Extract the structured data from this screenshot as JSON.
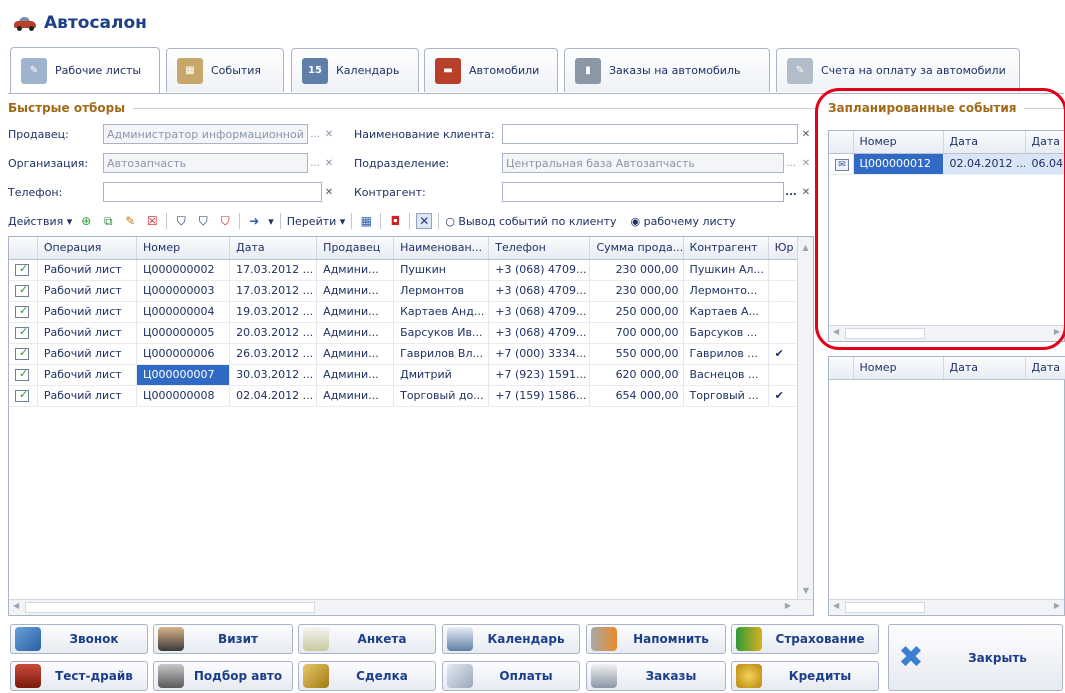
{
  "window": {
    "title": "Автосалон"
  },
  "tabs": [
    {
      "label": "Рабочие листы",
      "icon": "worksheet-icon"
    },
    {
      "label": "События",
      "icon": "events-icon"
    },
    {
      "label": "Календарь",
      "icon": "calendar-icon"
    },
    {
      "label": "Автомобили",
      "icon": "car-icon"
    },
    {
      "label": "Заказы на автомобиль",
      "icon": "order-icon"
    },
    {
      "label": "Счета на оплату за автомобили",
      "icon": "invoice-icon"
    }
  ],
  "filters": {
    "section_title": "Быстрые отборы",
    "seller_label": "Продавец:",
    "seller_value": "Администратор информационной",
    "client_label": "Наименование клиента:",
    "client_value": "",
    "org_label": "Организация:",
    "org_value": "Автозапчасть",
    "dept_label": "Подразделение:",
    "dept_value": "Центральная база Автозапчасть",
    "phone_label": "Телефон:",
    "phone_value": "",
    "contractor_label": "Контрагент:",
    "contractor_value": ""
  },
  "toolbar": {
    "actions_label": "Действия",
    "goto_label": "Перейти",
    "radio_client_label": "Вывод событий по клиенту",
    "radio_sheet_label": "рабочему листу"
  },
  "table": {
    "columns": [
      "Операция",
      "Номер",
      "Дата",
      "Продавец",
      "Наименован...",
      "Телефон",
      "Сумма прода...",
      "Контрагент",
      "Юр"
    ],
    "rows": [
      {
        "op": "Рабочий лист",
        "num": "Ц000000002",
        "date": "17.03.2012 ...",
        "seller": "Админи...",
        "name": "Пушкин",
        "phone": "+3 (068) 4709...",
        "sum": "230 000,00",
        "contractor": "Пушкин Ал...",
        "jur": ""
      },
      {
        "op": "Рабочий лист",
        "num": "Ц000000003",
        "date": "17.03.2012 ...",
        "seller": "Админи...",
        "name": "Лермонтов",
        "phone": "+3 (068) 4709...",
        "sum": "230 000,00",
        "contractor": "Лермонто...",
        "jur": ""
      },
      {
        "op": "Рабочий лист",
        "num": "Ц000000004",
        "date": "19.03.2012 ...",
        "seller": "Админи...",
        "name": "Картаев Анд...",
        "phone": "+3 (068) 4709...",
        "sum": "250 000,00",
        "contractor": "Картаев А...",
        "jur": ""
      },
      {
        "op": "Рабочий лист",
        "num": "Ц000000005",
        "date": "20.03.2012 ...",
        "seller": "Админи...",
        "name": "Барсуков Ив...",
        "phone": "+3 (068) 4709...",
        "sum": "700 000,00",
        "contractor": "Барсуков ...",
        "jur": ""
      },
      {
        "op": "Рабочий лист",
        "num": "Ц000000006",
        "date": "26.03.2012 ...",
        "seller": "Админи...",
        "name": "Гаврилов Вл...",
        "phone": "+7 (000) 3334...",
        "sum": "550 000,00",
        "contractor": "Гаврилов ...",
        "jur": "✔"
      },
      {
        "op": "Рабочий лист",
        "num": "Ц000000007",
        "date": "30.03.2012 ...",
        "seller": "Админи...",
        "name": "Дмитрий",
        "phone": "+7 (923) 1591...",
        "sum": "620 000,00",
        "contractor": "Васнецов ...",
        "jur": ""
      },
      {
        "op": "Рабочий лист",
        "num": "Ц000000008",
        "date": "02.04.2012 ...",
        "seller": "Админи...",
        "name": "Торговый до...",
        "phone": "+7 (159) 1586...",
        "sum": "654 000,00",
        "contractor": "Торговый ...",
        "jur": "✔"
      }
    ],
    "selected_row": 5
  },
  "planned": {
    "title": "Запланированные события",
    "columns": [
      "Номер",
      "Дата",
      "Дата"
    ],
    "rows": [
      {
        "num": "Ц000000012",
        "date": "02.04.2012 ...",
        "date2": "06.04"
      }
    ]
  },
  "lower_grid": {
    "columns": [
      "Номер",
      "Дата",
      "Дата"
    ]
  },
  "buttons": {
    "call": "Звонок",
    "visit": "Визит",
    "survey": "Анкета",
    "calendar": "Календарь",
    "remind": "Напомнить",
    "insurance": "Страхование",
    "test_drive": "Тест-драйв",
    "car_pick": "Подбор авто",
    "deal": "Сделка",
    "payments": "Оплаты",
    "orders": "Заказы",
    "credits": "Кредиты",
    "close": "Закрыть"
  },
  "colors": {
    "accent": "#1c3f8a",
    "section": "#a06a1a",
    "selection": "#316ac5",
    "highlight_ring": "#e3001b"
  }
}
